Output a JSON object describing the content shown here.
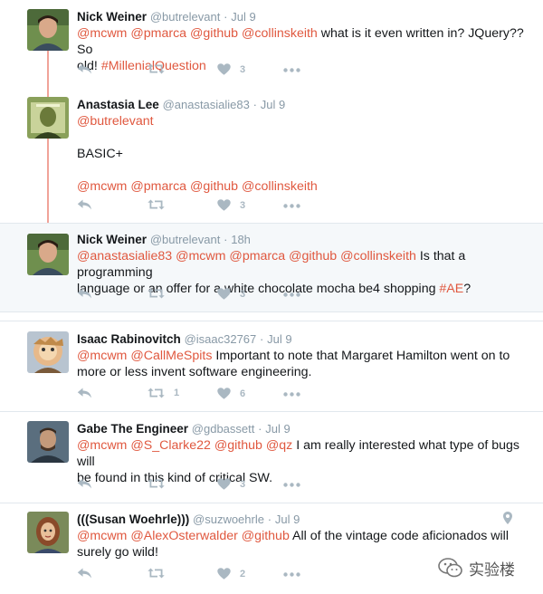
{
  "tweets": [
    {
      "name": "Nick Weiner",
      "handle": "@butrelevant",
      "time": "Jul 9",
      "lines": [
        [
          [
            "@mcwm",
            true
          ],
          [
            " ",
            false
          ],
          [
            "@pmarca",
            true
          ],
          [
            " ",
            false
          ],
          [
            "@github",
            true
          ],
          [
            " ",
            false
          ],
          [
            "@collinskeith",
            true
          ],
          [
            " what is it even written in? JQuery?? So",
            false
          ]
        ],
        [
          [
            "old! ",
            false
          ],
          [
            "#MillenialQuestion",
            true
          ]
        ]
      ],
      "retweets": "",
      "likes": "3"
    },
    {
      "name": "Anastasia Lee",
      "handle": "@anastasialie83",
      "time": "Jul 9",
      "lines": [
        [
          [
            "@butrelevant",
            true
          ]
        ],
        [
          [
            "",
            false
          ]
        ],
        [
          [
            "BASIC+",
            false
          ]
        ],
        [
          [
            "",
            false
          ]
        ],
        [
          [
            "@mcwm",
            true
          ],
          [
            " ",
            false
          ],
          [
            "@pmarca",
            true
          ],
          [
            " ",
            false
          ],
          [
            "@github",
            true
          ],
          [
            " ",
            false
          ],
          [
            "@collinskeith",
            true
          ]
        ]
      ],
      "retweets": "",
      "likes": "3"
    },
    {
      "name": "Nick Weiner",
      "handle": "@butrelevant",
      "time": "18h",
      "lines": [
        [
          [
            "@anastasialie83",
            true
          ],
          [
            " ",
            false
          ],
          [
            "@mcwm",
            true
          ],
          [
            " ",
            false
          ],
          [
            "@pmarca",
            true
          ],
          [
            " ",
            false
          ],
          [
            "@github",
            true
          ],
          [
            " ",
            false
          ],
          [
            "@collinskeith",
            true
          ],
          [
            " Is that a programming",
            false
          ]
        ],
        [
          [
            "language or an offer for a white chocolate mocha be4 shopping ",
            false
          ],
          [
            "#AE",
            true
          ],
          [
            "?",
            false
          ]
        ]
      ],
      "retweets": "",
      "likes": "3"
    },
    {
      "name": "Isaac Rabinovitch",
      "handle": "@isaac32767",
      "time": "Jul 9",
      "lines": [
        [
          [
            "@mcwm",
            true
          ],
          [
            " ",
            false
          ],
          [
            "@CallMeSpits",
            true
          ],
          [
            " Important to note that Margaret Hamilton went on to",
            false
          ]
        ],
        [
          [
            "more or less invent software engineering.",
            false
          ]
        ]
      ],
      "retweets": "1",
      "likes": "6"
    },
    {
      "name": "Gabe The Engineer",
      "handle": "@gdbassett",
      "time": "Jul 9",
      "lines": [
        [
          [
            "@mcwm",
            true
          ],
          [
            " ",
            false
          ],
          [
            "@S_Clarke22",
            true
          ],
          [
            " ",
            false
          ],
          [
            "@github",
            true
          ],
          [
            " ",
            false
          ],
          [
            "@qz",
            true
          ],
          [
            " I am really interested what type of bugs will",
            false
          ]
        ],
        [
          [
            "be found in this kind of critical SW.",
            false
          ]
        ]
      ],
      "retweets": "",
      "likes": "3"
    },
    {
      "name": "(((Susan Woehrle)))",
      "handle": "@suzwoehrle",
      "time": "Jul 9",
      "lines": [
        [
          [
            "@mcwm",
            true
          ],
          [
            " ",
            false
          ],
          [
            "@AlexOsterwalder",
            true
          ],
          [
            " ",
            false
          ],
          [
            "@github",
            true
          ],
          [
            " All of the vintage code aficionados will",
            false
          ]
        ],
        [
          [
            "surely go wild!",
            false
          ]
        ]
      ],
      "retweets": "",
      "likes": "2"
    }
  ],
  "watermark": "实验楼",
  "colors": {
    "mention": "#e0583f",
    "meta": "#8899a6",
    "icon": "#aab8c2",
    "thread": "#f0a399",
    "highlight": "#f5f8fa"
  }
}
